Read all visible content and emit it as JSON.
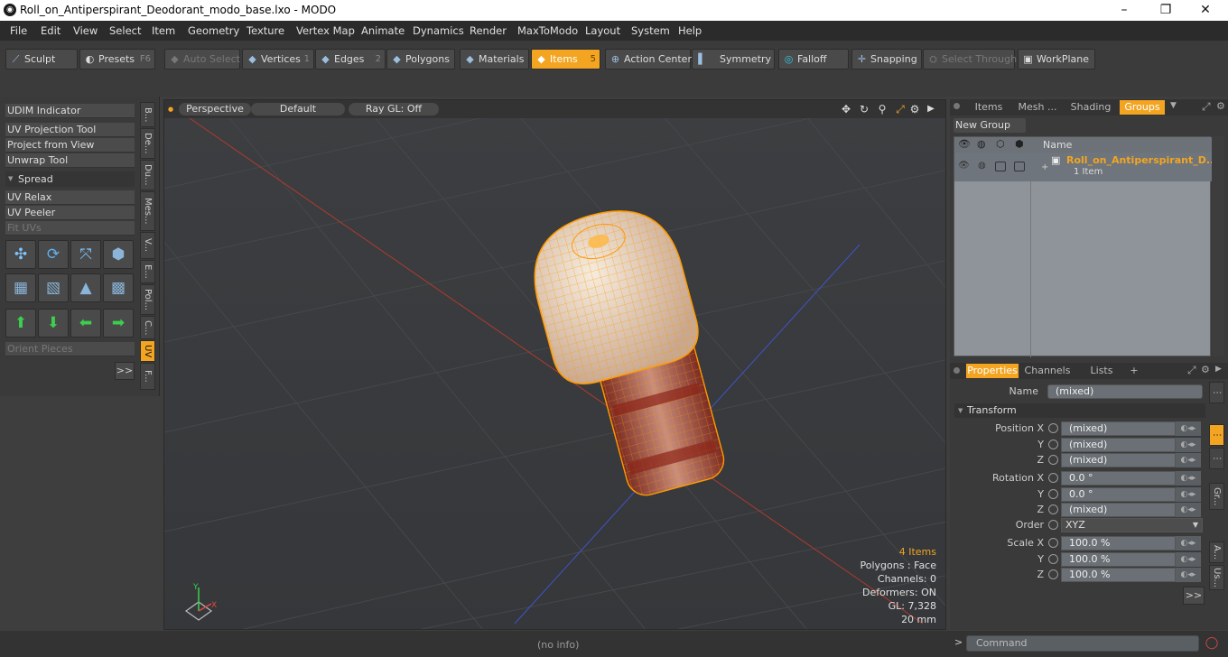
{
  "window": {
    "title": "Roll_on_Antiperspirant_Deodorant_modo_base.lxo - MODO",
    "minimize": "–",
    "maximize": "❐",
    "close": "✕"
  },
  "menu": [
    "File",
    "Edit",
    "View",
    "Select",
    "Item",
    "Geometry",
    "Texture",
    "Vertex Map",
    "Animate",
    "Dynamics",
    "Render",
    "MaxToModo",
    "Layout",
    "System",
    "Help"
  ],
  "toolbar": {
    "sculpt": "Sculpt",
    "presets": "Presets",
    "presets_key": "F6",
    "auto_select": "Auto Select",
    "vertices": "Vertices",
    "vertices_key": "1",
    "edges": "Edges",
    "edges_key": "2",
    "polygons": "Polygons",
    "materials": "Materials",
    "items": "Items",
    "items_key": "5",
    "action_center": "Action Center",
    "symmetry": "Symmetry",
    "falloff": "Falloff",
    "snapping": "Snapping",
    "select_through": "Select Through",
    "workplane": "WorkPlane"
  },
  "left": {
    "udim": "UDIM Indicator",
    "uvproj": "UV Projection Tool",
    "projview": "Project from View",
    "unwrap": "Unwrap Tool",
    "spread": "Spread",
    "relax": "UV Relax",
    "peeler": "UV Peeler",
    "fituvs": "Fit UVs",
    "orient": "Orient Pieces",
    "more": ">>",
    "tabs": [
      "B...",
      "De...",
      "Du...",
      "Mes...",
      "V...",
      "E...",
      "Pol...",
      "C...",
      "UV",
      "F..."
    ]
  },
  "viewport": {
    "perspective": "Perspective",
    "default": "Default",
    "raygl": "Ray GL: Off",
    "hud": {
      "items": "4 Items",
      "polygons": "Polygons : Face",
      "channels": "Channels: 0",
      "deformers": "Deformers: ON",
      "gl": "GL: 7,328",
      "units": "20 mm"
    },
    "axis_y": "Y",
    "axis_x": "X"
  },
  "status": {
    "info": "(no info)"
  },
  "right": {
    "tabs": [
      "Items",
      "Mesh ...",
      "Shading",
      "Groups"
    ],
    "new_group": "New Group",
    "col_name": "Name",
    "group_name": "Roll_on_Antiperspirant_D...",
    "group_count": "1 Item",
    "ptabs": [
      "Properties",
      "Channels",
      "Lists",
      "+"
    ],
    "name_label": "Name",
    "name_value": "(mixed)",
    "transform": "Transform",
    "position_label": "Position X",
    "rotation_label": "Rotation X",
    "scale_label": "Scale X",
    "y": "Y",
    "z": "Z",
    "position": [
      "(mixed)",
      "(mixed)",
      "(mixed)"
    ],
    "rotation": [
      "0.0 °",
      "0.0 °",
      "(mixed)"
    ],
    "order_label": "Order",
    "order_value": "XYZ",
    "scale": [
      "100.0 %",
      "100.0 %",
      "100.0 %"
    ],
    "more": ">>",
    "command": "Command",
    "prompt": ">",
    "strip": [
      "Gr...",
      "A...",
      "Us..."
    ]
  }
}
